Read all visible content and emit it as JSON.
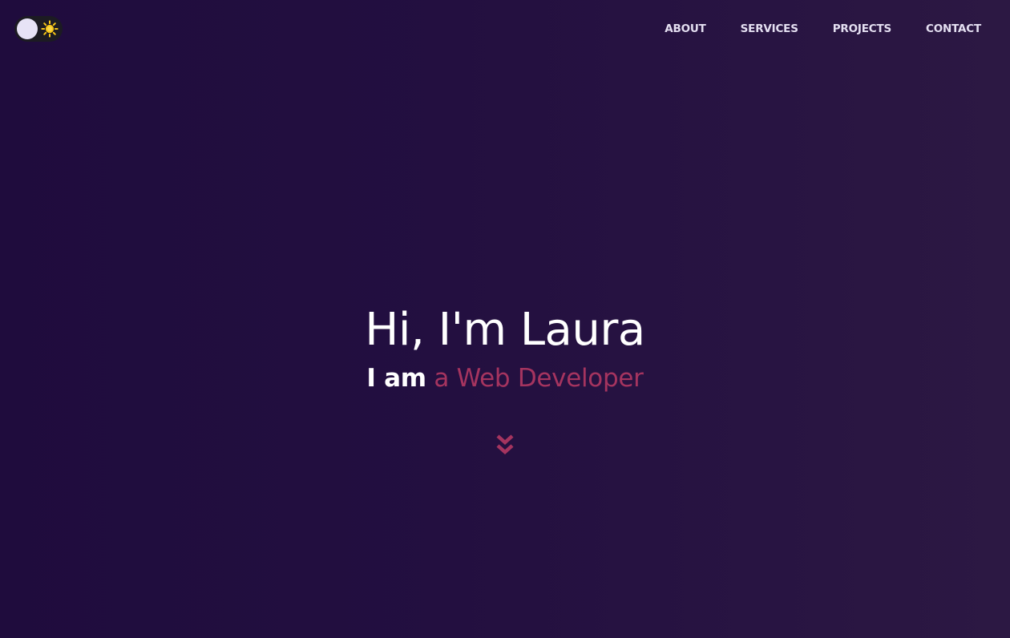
{
  "theme_toggle": {
    "icon": "sun-icon",
    "knob_color": "#e7e3f6",
    "icon_color": "#f5c518"
  },
  "nav": {
    "items": [
      {
        "label": "ABOUT"
      },
      {
        "label": "SERVICES"
      },
      {
        "label": "PROJECTS"
      },
      {
        "label": "CONTACT"
      }
    ]
  },
  "hero": {
    "title": "Hi, I'm Laura",
    "subtitle_lead": "I am",
    "subtitle_role": "a Web Developer"
  },
  "scroll_indicator": {
    "icon": "double-chevron-down-icon",
    "color": "#a5345f"
  },
  "colors": {
    "background": "#230f40",
    "accent": "#a5345f",
    "text": "#ffffff"
  }
}
